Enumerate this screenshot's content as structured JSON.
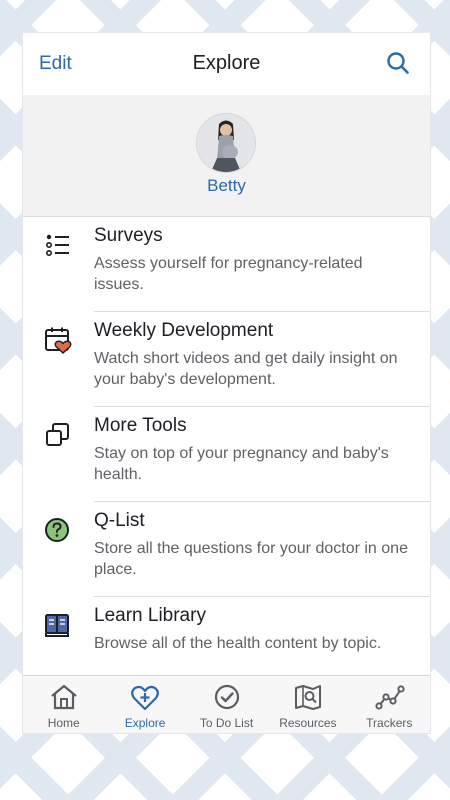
{
  "header": {
    "edit_label": "Edit",
    "title": "Explore",
    "search_icon": "search-icon"
  },
  "profile": {
    "name": "Betty"
  },
  "items": [
    {
      "icon": "list-icon",
      "title": "Surveys",
      "description": "Assess yourself for pregnancy-related issues."
    },
    {
      "icon": "calendar-heart-icon",
      "title": "Weekly Development",
      "description": "Watch short videos and get daily insight on your baby's development."
    },
    {
      "icon": "copy-squares-icon",
      "title": "More Tools",
      "description": "Stay on top of your pregnancy and baby's health."
    },
    {
      "icon": "question-circle-icon",
      "title": "Q-List",
      "description": "Store all the questions for your doctor in one place."
    },
    {
      "icon": "book-icon",
      "title": "Learn Library",
      "description": "Browse all of the health content by topic."
    }
  ],
  "tabs": [
    {
      "icon": "home-icon",
      "label": "Home",
      "active": false
    },
    {
      "icon": "heart-plus-icon",
      "label": "Explore",
      "active": true
    },
    {
      "icon": "check-circle-icon",
      "label": "To Do List",
      "active": false
    },
    {
      "icon": "map-search-icon",
      "label": "Resources",
      "active": false
    },
    {
      "icon": "trend-line-icon",
      "label": "Trackers",
      "active": false
    }
  ],
  "colors": {
    "accent": "#2a6aaa",
    "heart": "#e2694a",
    "question_fill": "#8cc47a",
    "book_fill": "#4f66a8"
  }
}
